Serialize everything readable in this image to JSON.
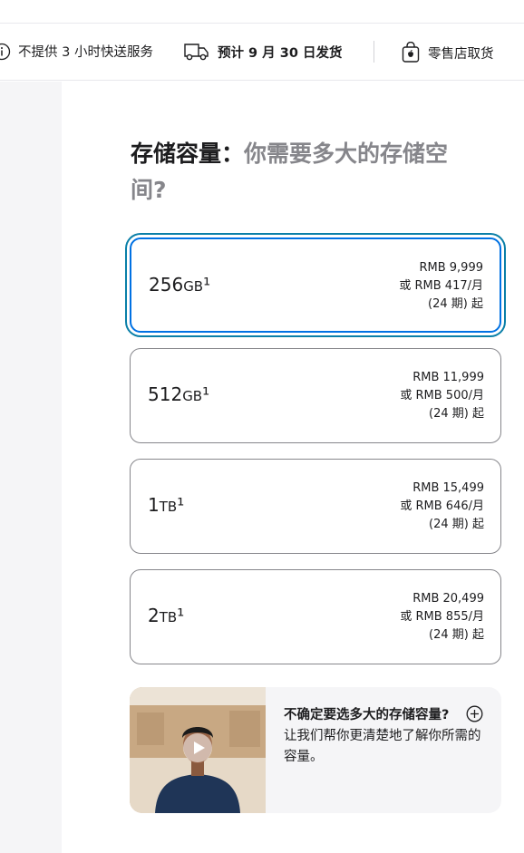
{
  "delivery": {
    "no_express": "不提供 3 小时快送服务",
    "ship_prefix": "预计 9 月 30 日发货",
    "pickup": "零售店取货"
  },
  "heading": {
    "title": "存储容量：",
    "subtitle": "你需要多大的存储空间?"
  },
  "options": [
    {
      "capacity": "256",
      "unit": "GB",
      "sup": "¹",
      "price": "RMB 9,999",
      "monthly": "或 RMB 417/月",
      "term": "(24 期) 起",
      "selected": true
    },
    {
      "capacity": "512",
      "unit": "GB",
      "sup": "¹",
      "price": "RMB 11,999",
      "monthly": "或 RMB 500/月",
      "term": "(24 期) 起",
      "selected": false
    },
    {
      "capacity": "1",
      "unit": "TB",
      "sup": "¹",
      "price": "RMB 15,499",
      "monthly": "或 RMB 646/月",
      "term": "(24 期) 起",
      "selected": false
    },
    {
      "capacity": "2",
      "unit": "TB",
      "sup": "¹",
      "price": "RMB 20,499",
      "monthly": "或 RMB 855/月",
      "term": "(24 期) 起",
      "selected": false
    }
  ],
  "help": {
    "title": "不确定要选多大的存储容量?",
    "body": "让我们帮你更清楚地了解你所需的容量。"
  },
  "colors": {
    "accent": "#0071e3",
    "selected_ring": "#0a7fa8",
    "muted": "#86868b",
    "panel_bg": "#f5f5f7"
  }
}
